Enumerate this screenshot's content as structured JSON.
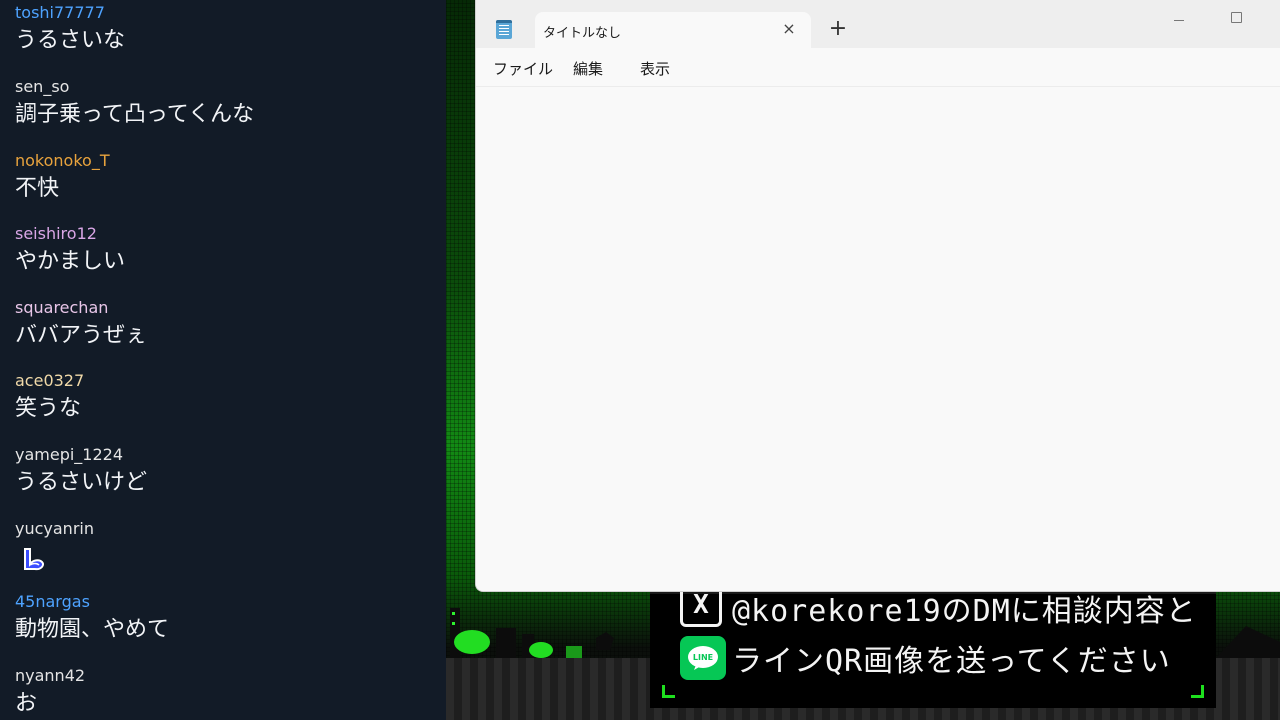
{
  "chat": {
    "messages": [
      {
        "user": "toshi77777",
        "text": "うるさいな",
        "color": "#4ea3ff"
      },
      {
        "user": "sen_so",
        "text": "調子乗って凸ってくんな",
        "color": "#e5e5e5"
      },
      {
        "user": "nokonoko_T",
        "text": "不快",
        "color": "#e8a33d"
      },
      {
        "user": "seishiro12",
        "text": "やかましい",
        "color": "#d9a6e6"
      },
      {
        "user": "squarechan",
        "text": "ババアうぜぇ",
        "color": "#e8c6e8"
      },
      {
        "user": "ace0327",
        "text": "笑うな",
        "color": "#f0d9a8"
      },
      {
        "user": "yamepi_1224",
        "text": "うるさいけど",
        "color": "#e5e5e5"
      },
      {
        "user": "yucyanrin",
        "text": "",
        "emote": "blue-swirl-emote",
        "color": "#e5e5e5"
      },
      {
        "user": "45nargas",
        "text": "動物園、やめて",
        "color": "#4ea3ff"
      },
      {
        "user": "nyann42",
        "text": "お",
        "color": "#e5e5e5"
      }
    ]
  },
  "notepad": {
    "tab_title": "タイトルなし",
    "close_symbol": "×",
    "new_tab_symbol": "+",
    "menu": [
      "ファイル",
      "編集",
      "表示"
    ],
    "content": ""
  },
  "game_banner": {
    "line1": "@korekore19のDMに相談内容と",
    "line2": "ラインQR画像を送ってください",
    "x_logo": "X",
    "line_icon_text": "LINE",
    "accent": "#06c755"
  }
}
